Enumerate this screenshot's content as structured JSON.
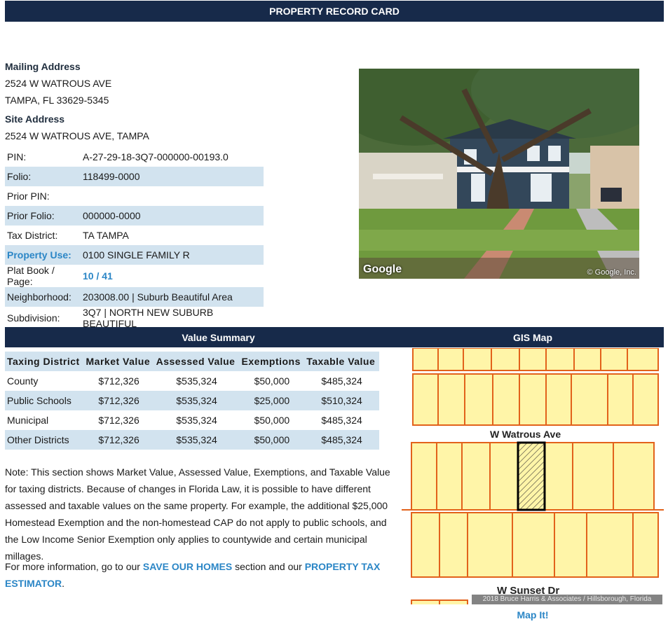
{
  "header": {
    "title": "PROPERTY RECORD CARD"
  },
  "mailing": {
    "label": "Mailing Address",
    "line1": "2524 W WATROUS AVE",
    "line2": "TAMPA, FL  33629-5345"
  },
  "site": {
    "label": "Site Address",
    "line1": "2524 W WATROUS AVE, TAMPA"
  },
  "info": [
    {
      "key": "PIN:",
      "value": "A-27-29-18-3Q7-000000-00193.0"
    },
    {
      "key": "Folio:",
      "value": "118499-0000"
    },
    {
      "key": "Prior PIN:",
      "value": ""
    },
    {
      "key": "Prior Folio:",
      "value": "000000-0000"
    },
    {
      "key": "Tax District:",
      "value": "TA TAMPA"
    },
    {
      "key": "Property Use:",
      "value": "0100 SINGLE FAMILY R"
    },
    {
      "key": "Plat Book / Page:",
      "value": "10 / 41"
    },
    {
      "key": "Neighborhood:",
      "value": "203008.00 | Suburb Beautiful Area"
    },
    {
      "key": "Subdivision:",
      "value": "3Q7 | NORTH NEW SUBURB BEAUTIFUL"
    }
  ],
  "photo": {
    "google_logo": "Google",
    "copyright": "© Google, Inc."
  },
  "value_summary": {
    "title": "Value Summary",
    "headers": [
      "Taxing District",
      "Market Value",
      "Assessed Value",
      "Exemptions",
      "Taxable Value"
    ],
    "rows": [
      [
        "County",
        "$712,326",
        "$535,324",
        "$50,000",
        "$485,324"
      ],
      [
        "Public Schools",
        "$712,326",
        "$535,324",
        "$25,000",
        "$510,324"
      ],
      [
        "Municipal",
        "$712,326",
        "$535,324",
        "$50,000",
        "$485,324"
      ],
      [
        "Other Districts",
        "$712,326",
        "$535,324",
        "$50,000",
        "$485,324"
      ]
    ]
  },
  "note": "Note: This section shows Market Value, Assessed Value, Exemptions, and Taxable Value for taxing districts. Because of changes in Florida Law, it is possible to have different assessed and taxable values on the same property. For example, the additional $25,000 Homestead Exemption and the non-homestead CAP do not apply to public schools, and the Low Income Senior Exemption only applies to countywide and certain municipal millages.",
  "more_info": {
    "prefix": "For more information, go to our ",
    "link1": "SAVE OUR HOMES",
    "middle": " section and our ",
    "link2": "PROPERTY TAX ESTIMATOR",
    "suffix": "."
  },
  "gis": {
    "title": "GIS Map",
    "street1": "W Watrous Ave",
    "street2": "W Sunset Dr",
    "credit": "2018 Bruce Harris & Associates / Hillsborough, Florida",
    "link": "Map It!"
  },
  "colors": {
    "header_bg": "#172a4a",
    "row_shade": "#d2e3ef",
    "link": "#2b86c6",
    "parcel_fill": "#fff5a8",
    "parcel_line": "#e2621b"
  }
}
